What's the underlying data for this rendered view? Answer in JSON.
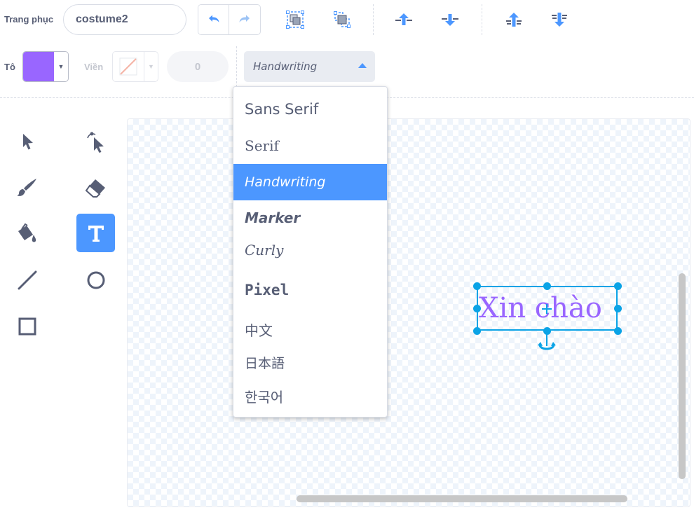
{
  "toolbar": {
    "costume_label": "Trang phục",
    "costume_name": "costume2",
    "undo_icon": "undo-icon",
    "redo_icon": "redo-icon",
    "icons": [
      "group-icon",
      "ungroup-icon",
      "forward-icon",
      "backward-icon",
      "front-icon",
      "back-icon"
    ]
  },
  "style_row": {
    "fill_label": "Tô",
    "fill_color": "#9966ff",
    "outline_label": "Viền",
    "stroke_width": "0",
    "font_selected": "Handwriting"
  },
  "font_menu": {
    "options": [
      "Sans Serif",
      "Serif",
      "Handwriting",
      "Marker",
      "Curly",
      "Pixel",
      "中文",
      "日本語",
      "한국어"
    ],
    "selected": "Handwriting"
  },
  "tools": [
    "select-icon",
    "reshape-icon",
    "brush-icon",
    "eraser-icon",
    "fill-icon",
    "text-icon",
    "line-icon",
    "circle-icon",
    "rectangle-icon"
  ],
  "active_tool": "text-icon",
  "canvas": {
    "text": "Xin chào",
    "text_color": "#9966ff"
  },
  "colors": {
    "accent": "#4c97ff",
    "selection": "#0aa3e6",
    "text": "#575e75"
  }
}
